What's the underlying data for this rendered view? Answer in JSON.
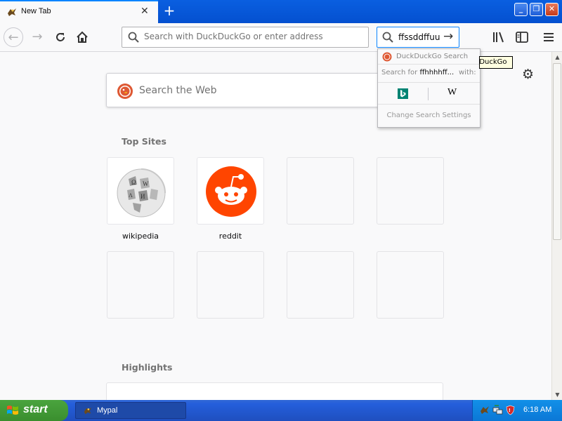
{
  "window": {
    "tab_title": "New Tab",
    "tab_close_icon": "close-icon",
    "new_tab_label": "+"
  },
  "toolbar": {
    "url_placeholder": "Search with DuckDuckGo or enter address",
    "search_value": "ffssddffuu"
  },
  "newtab": {
    "search_placeholder": "Search the Web",
    "top_sites_title": "Top Sites",
    "highlights_title": "Highlights",
    "tiles": [
      {
        "label": "wikipedia",
        "icon": "wikipedia-globe-icon"
      },
      {
        "label": "reddit",
        "icon": "reddit-icon"
      },
      {
        "label": "",
        "icon": ""
      },
      {
        "label": "",
        "icon": ""
      },
      {
        "label": "",
        "icon": ""
      },
      {
        "label": "",
        "icon": ""
      },
      {
        "label": "",
        "icon": ""
      },
      {
        "label": "",
        "icon": ""
      }
    ]
  },
  "search_popup": {
    "engine_label": "DuckDuckGo Search",
    "search_for_label": "Search for",
    "query": "ffhhhhff...",
    "with_label": "with:",
    "engines": [
      "bing-icon",
      "wikipedia-icon"
    ],
    "wiki_glyph": "W",
    "settings_label": "Change Search Settings"
  },
  "tooltip": {
    "text": "DuckDuckGo"
  },
  "taskbar": {
    "start_label": "start",
    "task_label": "Mypal",
    "clock": "6:18 AM"
  },
  "colors": {
    "accent": "#0a84ff",
    "titlebar": "#0450d0",
    "start_green": "#3a8e2e",
    "ddg_orange": "#de5833",
    "reddit_orange": "#ff4500"
  }
}
